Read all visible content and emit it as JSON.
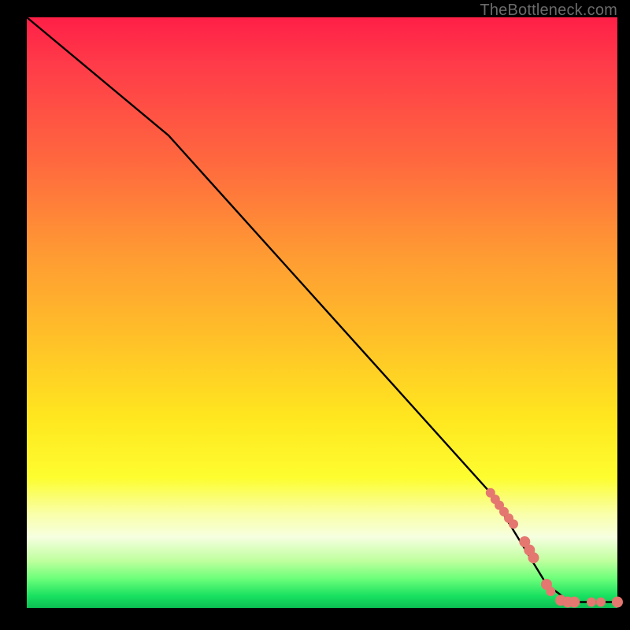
{
  "watermark": "TheBottleneck.com",
  "palette": {
    "dot": "#e4776f",
    "line": "#000000"
  },
  "chart_data": {
    "type": "line",
    "title": "",
    "xlabel": "",
    "ylabel": "",
    "xlim": [
      0,
      100
    ],
    "ylim": [
      0,
      100
    ],
    "grid": false,
    "legend": false,
    "curve": [
      {
        "x": 0.0,
        "y": 100.0
      },
      {
        "x": 24.0,
        "y": 80.0
      },
      {
        "x": 78.5,
        "y": 19.5
      },
      {
        "x": 88.0,
        "y": 4.0
      },
      {
        "x": 92.0,
        "y": 1.0
      },
      {
        "x": 100.0,
        "y": 1.0
      }
    ],
    "series": [
      {
        "name": "points",
        "color": "#e4776f",
        "data": [
          {
            "x": 78.5,
            "y": 19.5,
            "r": 6
          },
          {
            "x": 79.3,
            "y": 18.4,
            "r": 6
          },
          {
            "x": 80.0,
            "y": 17.4,
            "r": 6
          },
          {
            "x": 80.8,
            "y": 16.3,
            "r": 6
          },
          {
            "x": 81.6,
            "y": 15.2,
            "r": 6
          },
          {
            "x": 82.4,
            "y": 14.2,
            "r": 6
          },
          {
            "x": 84.3,
            "y": 11.2,
            "r": 7
          },
          {
            "x": 85.1,
            "y": 9.8,
            "r": 7
          },
          {
            "x": 85.8,
            "y": 8.5,
            "r": 7
          },
          {
            "x": 88.0,
            "y": 4.0,
            "r": 7
          },
          {
            "x": 88.7,
            "y": 2.8,
            "r": 6
          },
          {
            "x": 90.4,
            "y": 1.3,
            "r": 7
          },
          {
            "x": 91.6,
            "y": 1.0,
            "r": 7
          },
          {
            "x": 92.7,
            "y": 1.0,
            "r": 7
          },
          {
            "x": 95.6,
            "y": 1.0,
            "r": 6
          },
          {
            "x": 97.2,
            "y": 1.0,
            "r": 6
          },
          {
            "x": 100.0,
            "y": 1.0,
            "r": 7
          }
        ]
      }
    ]
  }
}
